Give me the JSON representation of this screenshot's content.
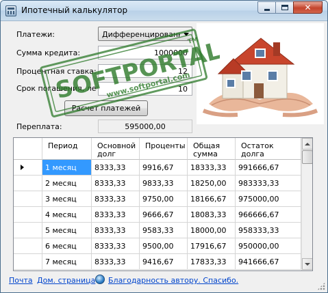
{
  "window": {
    "title": "Ипотечный калькулятор",
    "controls": {
      "minimize": "—",
      "maximize": "□",
      "close": "✕"
    }
  },
  "form": {
    "payments_label": "Платежи:",
    "payments_value": "Дифференцированные",
    "loan_label": "Сумма кредита:",
    "loan_value": "1000000",
    "rate_label": "Процентная ставка:",
    "rate_value": "12",
    "term_label": "Срок погашения, лет",
    "term_value": "10",
    "calc_button": "Расчет платежей",
    "overpay_label": "Переплата:",
    "overpay_value": "595000,00"
  },
  "watermark": {
    "brand": "SOFTPORTAL",
    "url": "www.softportal.com",
    "tm": "TM"
  },
  "table": {
    "headers": [
      "Период",
      "Основной долг",
      "Проценты",
      "Общая сумма",
      "Остаток долга"
    ],
    "header_lines": [
      [
        "Период",
        ""
      ],
      [
        "Основной",
        "долг"
      ],
      [
        "Проценты",
        ""
      ],
      [
        "Общая",
        "сумма"
      ],
      [
        "Остаток",
        "долга"
      ]
    ],
    "rows": [
      [
        "1 месяц",
        "8333,33",
        "9916,67",
        "18333,33",
        "991666,67"
      ],
      [
        "2 месяц",
        "8333,33",
        "9833,33",
        "18250,00",
        "983333,33"
      ],
      [
        "3 месяц",
        "8333,33",
        "9750,00",
        "18166,67",
        "975000,00"
      ],
      [
        "4 месяц",
        "8333,33",
        "9666,67",
        "18083,33",
        "966666,67"
      ],
      [
        "5 месяц",
        "8333,33",
        "9583,33",
        "18000,00",
        "958333,33"
      ],
      [
        "6 месяц",
        "8333,33",
        "9500,00",
        "17916,67",
        "950000,00"
      ],
      [
        "7 месяц",
        "8333,33",
        "9416,67",
        "17833,33",
        "941666,67"
      ]
    ],
    "selected_row": 0
  },
  "footer": {
    "mail": "Почта",
    "homepage": "Дом. страница",
    "thanks": "Благодарность автору. Спасибо."
  },
  "colors": {
    "selection": "#3399ff",
    "link": "#0044cc",
    "watermark": "#2d7a2a"
  }
}
